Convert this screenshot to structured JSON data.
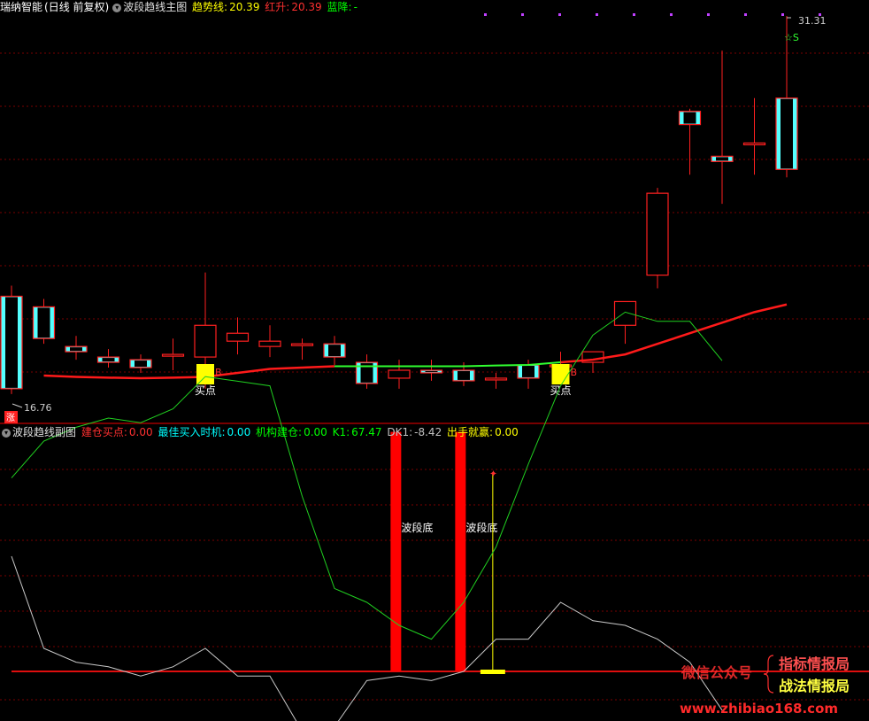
{
  "main_header": {
    "stock_name": "瑞纳智能",
    "period": "(日线 前复权)",
    "indicator": "波段趋线主图",
    "items": [
      {
        "label": "趋势线:",
        "value": "20.39",
        "color": "#ffff00"
      },
      {
        "label": "红升:",
        "value": "20.39",
        "color": "#ff3030"
      },
      {
        "label": "蓝降:",
        "value": "-",
        "color": "#00ff00"
      }
    ]
  },
  "sub_header": {
    "indicator": "波段趋线副图",
    "items": [
      {
        "label": "建仓买点:",
        "value": "0.00",
        "color": "#ff3030"
      },
      {
        "label": "最佳买入时机:",
        "value": "0.00",
        "color": "#00ffff"
      },
      {
        "label": "机构建仓:",
        "value": "0.00",
        "color": "#00ff00"
      },
      {
        "label": "K1:",
        "value": "67.47",
        "color": "#00ff00"
      },
      {
        "label": "DK1:",
        "value": "-8.42",
        "color": "#c0c0c0"
      },
      {
        "label": "出手就赢:",
        "value": "0.00",
        "color": "#ffff00"
      }
    ]
  },
  "colors": {
    "up": "#ff2020",
    "down": "#54ffff",
    "trend": "#ff1a1a",
    "flat": "#30ff30",
    "k1": "#20d020",
    "dk1": "#c8c8c8",
    "bar": "#ff0000",
    "signal": "#ffff00",
    "grid": "#7a0000",
    "divider": "#a00000"
  },
  "chart_data": [
    {
      "type": "candlestick",
      "title": "波段趋线主图",
      "high_label": "31.31",
      "low_label": "16.76",
      "candles": [
        {
          "o": 20.7,
          "h": 21.1,
          "l": 17.0,
          "c": 17.2
        },
        {
          "o": 20.3,
          "h": 20.6,
          "l": 18.9,
          "c": 19.1
        },
        {
          "o": 18.8,
          "h": 19.2,
          "l": 18.3,
          "c": 18.6
        },
        {
          "o": 18.4,
          "h": 18.7,
          "l": 18.0,
          "c": 18.2
        },
        {
          "o": 18.3,
          "h": 18.5,
          "l": 17.8,
          "c": 18.0
        },
        {
          "o": 18.5,
          "h": 19.1,
          "l": 17.9,
          "c": 18.5
        },
        {
          "o": 18.4,
          "h": 21.6,
          "l": 17.2,
          "c": 19.6
        },
        {
          "o": 19.0,
          "h": 19.9,
          "l": 18.5,
          "c": 19.3
        },
        {
          "o": 18.8,
          "h": 19.6,
          "l": 18.4,
          "c": 19.0
        },
        {
          "o": 18.9,
          "h": 19.1,
          "l": 18.3,
          "c": 18.9
        },
        {
          "o": 18.9,
          "h": 19.2,
          "l": 18.1,
          "c": 18.4
        },
        {
          "o": 18.2,
          "h": 18.5,
          "l": 17.2,
          "c": 17.4
        },
        {
          "o": 17.6,
          "h": 18.3,
          "l": 17.2,
          "c": 17.9
        },
        {
          "o": 17.9,
          "h": 18.3,
          "l": 17.5,
          "c": 17.8
        },
        {
          "o": 17.9,
          "h": 18.2,
          "l": 17.3,
          "c": 17.5
        },
        {
          "o": 17.6,
          "h": 17.8,
          "l": 17.2,
          "c": 17.6
        },
        {
          "o": 18.1,
          "h": 18.3,
          "l": 17.2,
          "c": 17.6
        },
        {
          "o": 18.1,
          "h": 18.6,
          "l": 17.8,
          "c": 18.1
        },
        {
          "o": 18.2,
          "h": 18.6,
          "l": 17.8,
          "c": 18.6
        },
        {
          "o": 19.6,
          "h": 19.9,
          "l": 18.9,
          "c": 20.5
        },
        {
          "o": 21.5,
          "h": 24.8,
          "l": 21.0,
          "c": 24.6
        },
        {
          "o": 27.7,
          "h": 27.8,
          "l": 25.3,
          "c": 27.2
        },
        {
          "o": 26.0,
          "h": 30.0,
          "l": 24.2,
          "c": 25.8
        },
        {
          "o": 26.5,
          "h": 28.2,
          "l": 25.3,
          "c": 26.5
        },
        {
          "o": 28.2,
          "h": 31.31,
          "l": 25.2,
          "c": 25.5
        }
      ],
      "trend_line": [
        null,
        17.7,
        17.65,
        17.62,
        17.6,
        17.62,
        17.65,
        17.8,
        17.95,
        18.0,
        18.05,
        18.05,
        18.05,
        18.05,
        18.05,
        18.08,
        18.1,
        18.2,
        18.3,
        18.5,
        18.9,
        19.3,
        19.7,
        20.1,
        20.39
      ],
      "trend_flat_range": [
        10,
        17
      ],
      "markers": [
        {
          "index": 6,
          "label": "买点"
        },
        {
          "index": 17,
          "label": "买点"
        }
      ],
      "star_label": "☆S"
    },
    {
      "type": "indicator",
      "title": "波段趋线副图",
      "ylim": [
        -15,
        100
      ],
      "series": [
        {
          "name": "K1",
          "values": [
            42,
            50,
            53,
            55,
            54,
            57,
            64,
            63,
            62,
            38,
            18,
            15,
            10,
            7,
            15,
            27,
            45,
            62,
            73,
            78,
            76,
            76,
            67.47
          ]
        },
        {
          "name": "DK1",
          "values": [
            25,
            5,
            2,
            1,
            -1,
            1,
            5,
            -1,
            -1,
            -13,
            -12,
            -2,
            -1,
            -2,
            0,
            7,
            7,
            15,
            11,
            10,
            7,
            2,
            -8.42
          ]
        }
      ],
      "bars": [
        {
          "index": 11.9,
          "label": "波段底",
          "value": 52
        },
        {
          "index": 13.9,
          "label": "波段底",
          "value": 52
        }
      ],
      "signal_index": 14.9,
      "signal_high": 43,
      "zero_value": 0
    }
  ],
  "watermark": {
    "text1": "微信公众号",
    "text2": "指标情报局",
    "text3": "战法情报局",
    "url": "www.zhibiao168.com"
  }
}
